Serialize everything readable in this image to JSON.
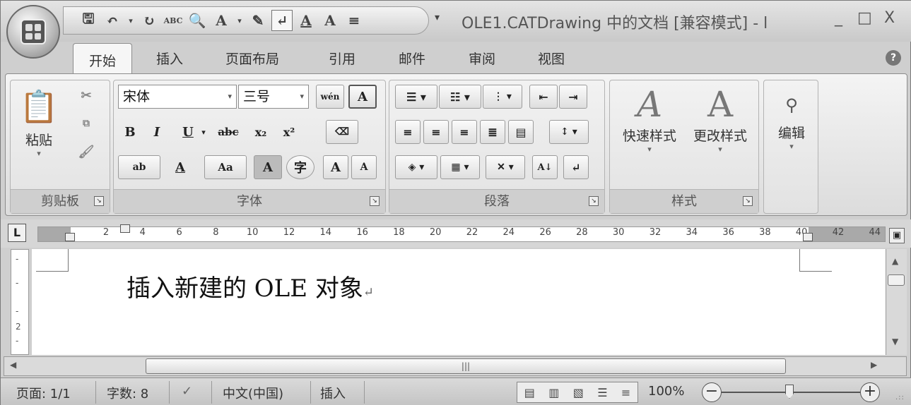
{
  "window": {
    "title": "OLE1.CATDrawing 中的文档 [兼容模式] - l",
    "controls": [
      "_",
      "□",
      "X"
    ]
  },
  "quick_access": {
    "more": "▾"
  },
  "tabs": [
    "开始",
    "插入",
    "页面布局",
    "引用",
    "邮件",
    "审阅",
    "视图"
  ],
  "ribbon": {
    "clipboard": {
      "paste_label": "粘贴",
      "group_label": "剪贴板"
    },
    "font": {
      "font_name": "宋体",
      "font_size": "三号",
      "group_label": "字体",
      "bold": "B",
      "italic": "I",
      "underline": "U",
      "strike": "abc",
      "subscript": "x₂",
      "superscript": "x²",
      "highlight": "ab",
      "font_color": "A",
      "change_case": "Aa",
      "char_shading": "A",
      "enclose": "字",
      "grow": "A",
      "shrink": "A",
      "phonetic": "wén",
      "border": "A"
    },
    "paragraph": {
      "group_label": "段落",
      "sort": "A↓"
    },
    "styles": {
      "quick_styles": "快速样式",
      "change_styles": "更改样式",
      "group_label": "样式"
    },
    "editing": {
      "label": "编辑"
    }
  },
  "ruler": {
    "ticks": [
      "2",
      "4",
      "6",
      "8",
      "10",
      "12",
      "14",
      "16",
      "18",
      "20",
      "22",
      "24",
      "26",
      "28",
      "30",
      "32",
      "34",
      "36",
      "38",
      "40",
      "42",
      "44"
    ]
  },
  "document": {
    "text": "插入新建的 OLE 对象",
    "para_mark": "↵",
    "vruler_ticks": [
      "-",
      "-",
      "-",
      "2",
      "-"
    ]
  },
  "status": {
    "page": "页面: 1/1",
    "words": "字数: 8",
    "language": "中文(中国)",
    "mode": "插入",
    "zoom": "100%"
  },
  "colors": {
    "chrome": "#cfcfcf",
    "ribbon": "#e6e6e6",
    "page": "#ffffff"
  }
}
